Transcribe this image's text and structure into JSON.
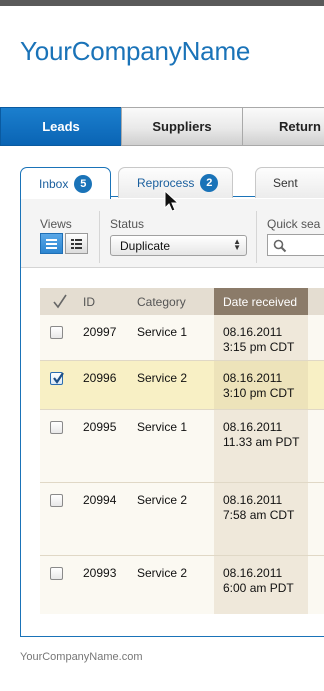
{
  "brand": {
    "name": "YourCompanyName"
  },
  "main_tabs": [
    {
      "label": "Leads",
      "active": true
    },
    {
      "label": "Suppliers",
      "active": false
    },
    {
      "label": "Return",
      "active": false
    }
  ],
  "sub_tabs": [
    {
      "label": "Inbox",
      "badge": "5",
      "active": true
    },
    {
      "label": "Reprocess",
      "badge": "2",
      "active": false
    },
    {
      "label": "Sent",
      "active": false
    }
  ],
  "filters": {
    "views_label": "Views",
    "status_label": "Status",
    "status_value": "Duplicate",
    "quick_search_label": "Quick sea"
  },
  "table": {
    "columns": {
      "id": "ID",
      "category": "Category",
      "date": "Date received"
    },
    "rows": [
      {
        "id": "20997",
        "category": "Service 1",
        "date": "08.16.2011",
        "time": "3:15 pm CDT",
        "checked": false
      },
      {
        "id": "20996",
        "category": "Service 2",
        "date": "08.16.2011",
        "time": "3:10 pm CDT",
        "checked": true
      },
      {
        "id": "20995",
        "category": "Service 1",
        "date": "08.16.2011",
        "time": "11.33 am PDT",
        "checked": false
      },
      {
        "id": "20994",
        "category": "Service 2",
        "date": "08.16.2011",
        "time": "7:58 am CDT",
        "checked": false
      },
      {
        "id": "20993",
        "category": "Service 2",
        "date": "08.16.2011",
        "time": "6:00 am PDT",
        "checked": false
      }
    ]
  },
  "footer": {
    "text": "YourCompanyName.com"
  },
  "colors": {
    "accent": "#1a73b8",
    "selected_row": "#f8f0c5",
    "date_header": "#8b7b69"
  }
}
